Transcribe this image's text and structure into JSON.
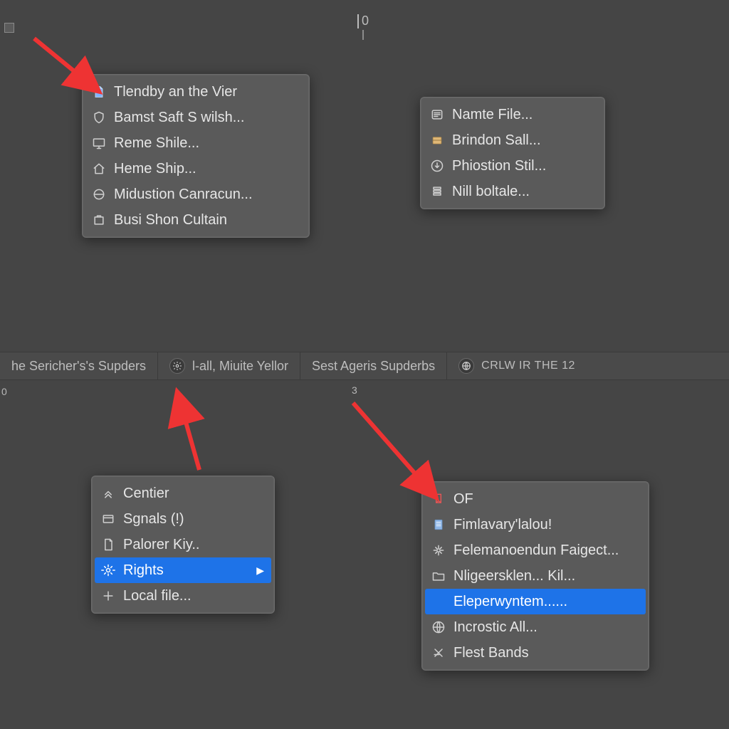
{
  "top_marks": {
    "zero": "0"
  },
  "midbar": {
    "segments": [
      {
        "label": "he Sericher's's Supders"
      },
      {
        "icon": "gear",
        "label": "l-all, Miuite Yellor"
      },
      {
        "label": "Sest Ageris Supderbs"
      },
      {
        "icon": "globe",
        "label": "CRLW IR THE 12"
      }
    ]
  },
  "tiny": {
    "bottom_left": "0",
    "bottom_center": "3"
  },
  "menu1": {
    "items": [
      {
        "icon": "file-solid",
        "label": "Tlendby an the Vier"
      },
      {
        "icon": "shield",
        "label": "Bamst Saft S wilsh..."
      },
      {
        "icon": "display",
        "label": "Reme Shile..."
      },
      {
        "icon": "home",
        "label": "Heme Ship..."
      },
      {
        "icon": "target",
        "label": "Midustion Canracun..."
      },
      {
        "icon": "box",
        "label": "Busi Shon Cultain"
      }
    ]
  },
  "menu2": {
    "items": [
      {
        "icon": "list",
        "label": "Namte File..."
      },
      {
        "icon": "drawer",
        "label": "Brindon Sall..."
      },
      {
        "icon": "download",
        "label": "Phiostion Stil..."
      },
      {
        "icon": "stack",
        "label": "Nill boltale..."
      }
    ]
  },
  "menu3": {
    "items": [
      {
        "icon": "chevrons-up",
        "label": "Centier"
      },
      {
        "icon": "panel",
        "label": "Sgnals (!)"
      },
      {
        "icon": "page",
        "label": "Palorer Kiy.."
      },
      {
        "icon": "gear",
        "label": "Rights",
        "selected": true,
        "submenu": true
      },
      {
        "icon": "plus",
        "label": "Local file..."
      }
    ]
  },
  "menu4": {
    "items": [
      {
        "icon": "bookmark",
        "label": "OF"
      },
      {
        "icon": "sheet",
        "label": "Fimlavary'lalou!"
      },
      {
        "icon": "sparkle",
        "label": "Felemanoendun Faigect..."
      },
      {
        "icon": "folder",
        "label": "Nligeersklen... Kil..."
      },
      {
        "icon": "blank",
        "label": "Eleperwyntem......",
        "selected": true
      },
      {
        "icon": "globe",
        "label": "Incrostic All..."
      },
      {
        "icon": "strike",
        "label": "Flest Bands"
      }
    ]
  }
}
